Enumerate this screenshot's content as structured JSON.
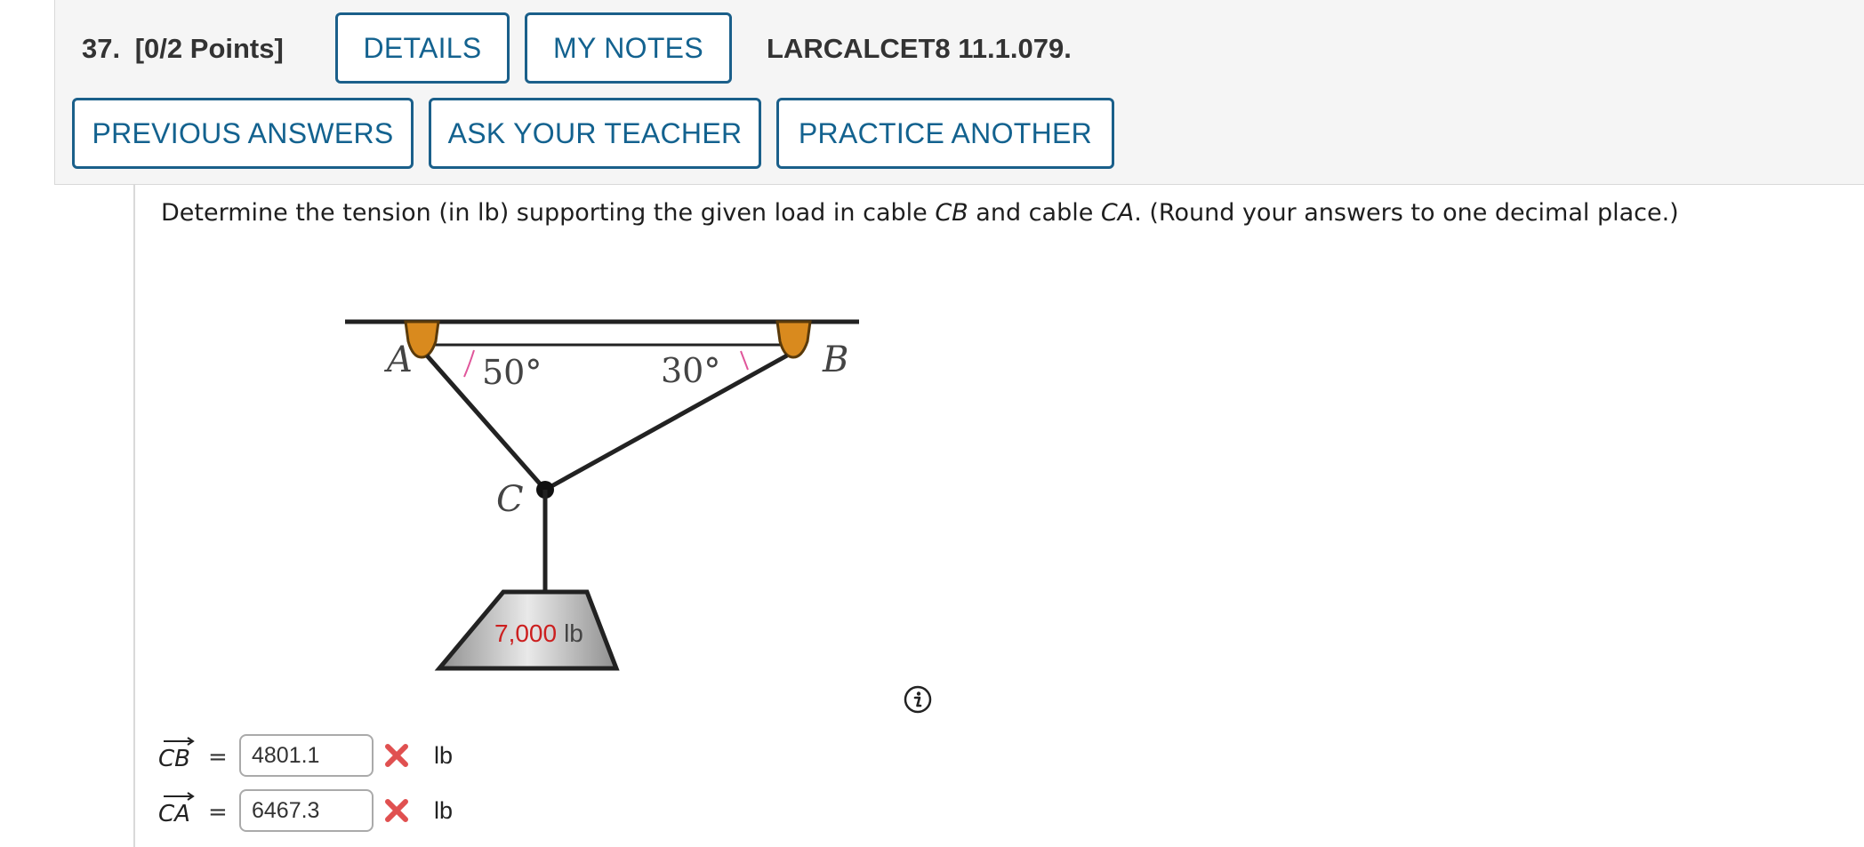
{
  "question": {
    "number": "37.",
    "points": "[0/2 Points]",
    "code": "LARCALCET8 11.1.079.",
    "buttons": {
      "details": "DETAILS",
      "my_notes": "MY NOTES",
      "previous_answers": "PREVIOUS ANSWERS",
      "ask_teacher": "ASK YOUR TEACHER",
      "practice_another": "PRACTICE ANOTHER"
    },
    "prompt_part1": "Determine the tension (in lb) supporting the given load in cable ",
    "cable_1": "CB",
    "prompt_part2": " and cable ",
    "cable_2": "CA",
    "prompt_part3": ". (Round your answers to one decimal place.)"
  },
  "figure": {
    "point_a": "A",
    "point_b": "B",
    "point_c": "C",
    "angle_a": "50°",
    "angle_b": "30°",
    "load_value": "7,000",
    "load_unit": "lb",
    "colors": {
      "load_value": "#cc1f1f",
      "support": "#d98a1e",
      "angle_arc": "#e0559a"
    }
  },
  "answers": [
    {
      "vector": "CB",
      "equals": "=",
      "value": "4801.1",
      "status": "incorrect",
      "unit": "lb"
    },
    {
      "vector": "CA",
      "equals": "=",
      "value": "6467.3",
      "status": "incorrect",
      "unit": "lb"
    }
  ],
  "icons": {
    "info": "info-icon",
    "incorrect": "x-mark-icon",
    "vector_arrow": "vector-arrow-icon"
  },
  "colors": {
    "button_border": "#1a5f8a",
    "button_text": "#13628f",
    "incorrect_mark": "#e05050"
  }
}
